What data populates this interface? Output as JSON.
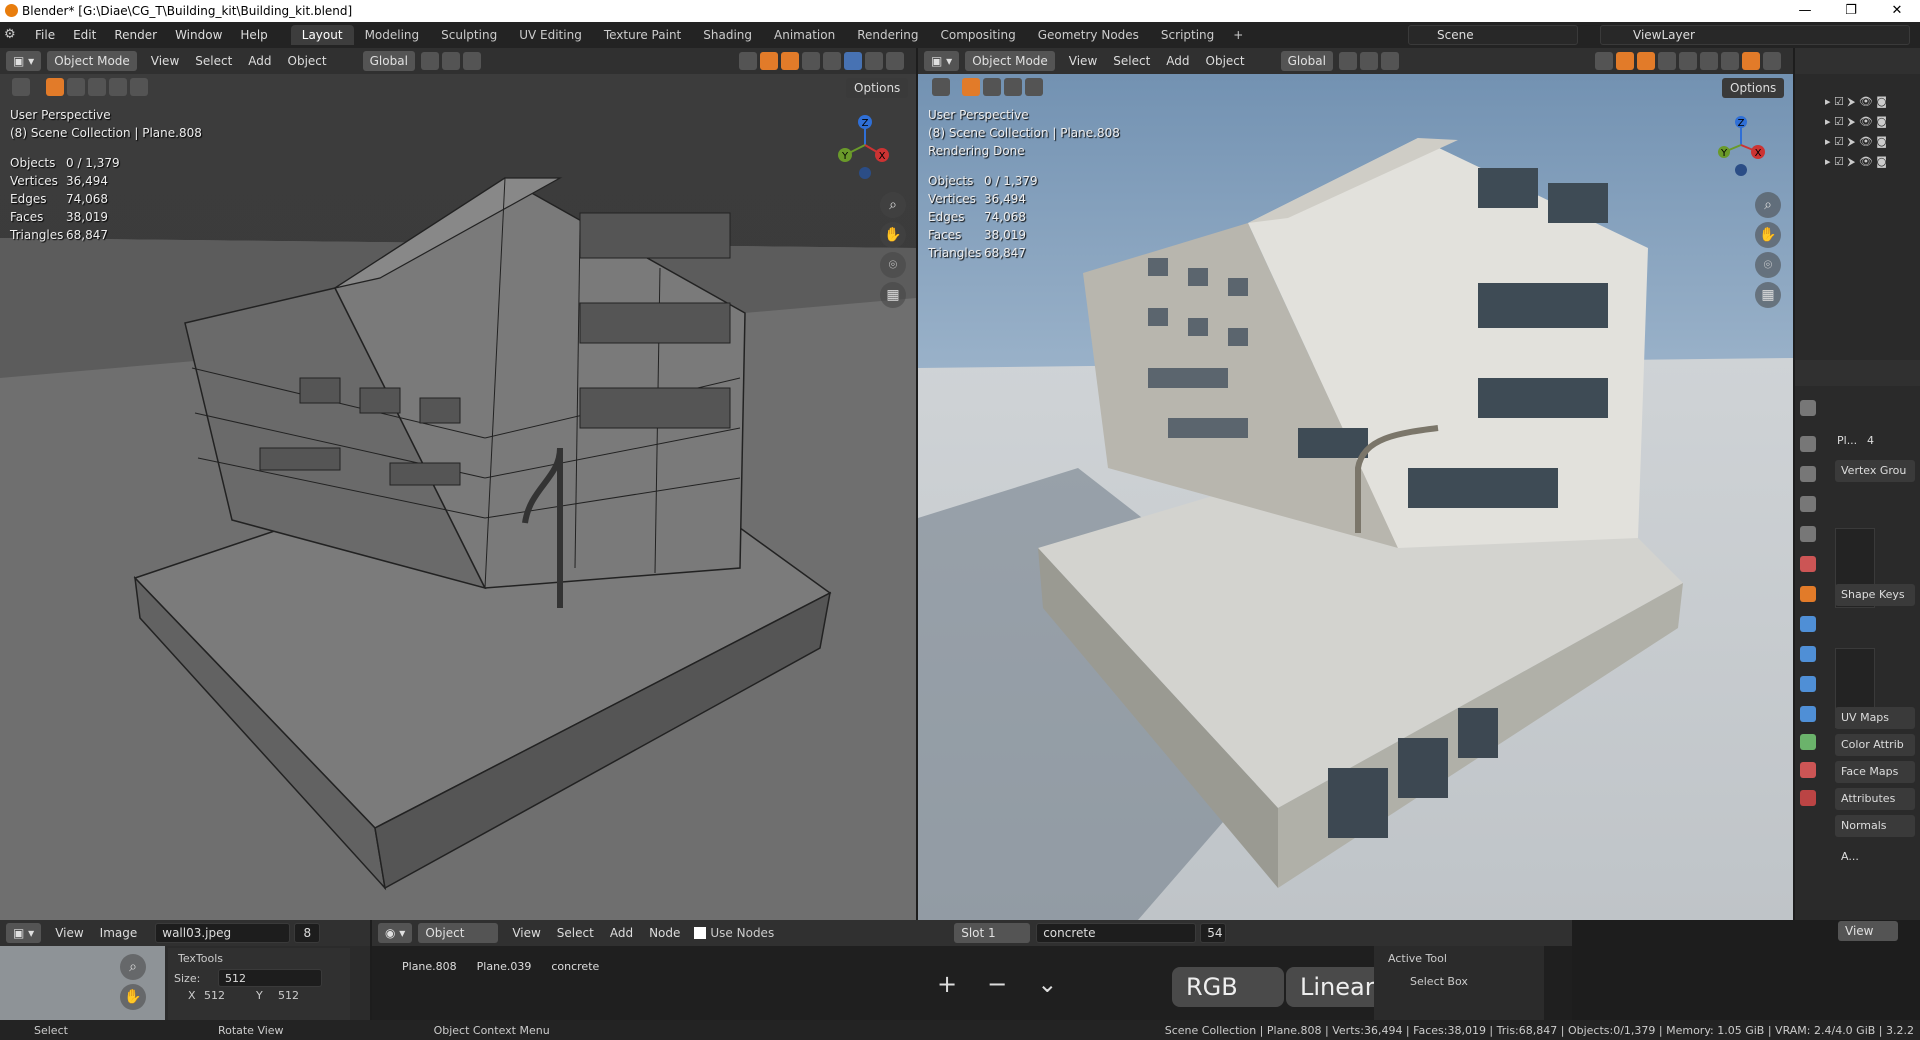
{
  "window": {
    "title": "Blender* [G:\\Diae\\CG_T\\Building_kit\\Building_kit.blend]",
    "min": "—",
    "max": "❐",
    "close": "✕"
  },
  "menus": [
    "File",
    "Edit",
    "Render",
    "Window",
    "Help"
  ],
  "workspaces": [
    "Layout",
    "Modeling",
    "Sculpting",
    "UV Editing",
    "Texture Paint",
    "Shading",
    "Animation",
    "Rendering",
    "Compositing",
    "Geometry Nodes",
    "Scripting"
  ],
  "scene": "Scene",
  "view_layer": "ViewLayer",
  "viewport_left": {
    "mode": "Object Mode",
    "menus": [
      "View",
      "Select",
      "Add",
      "Object"
    ],
    "orientation": "Global",
    "options": "Options",
    "info": [
      "User Perspective",
      "(8) Scene Collection | Plane.808"
    ],
    "stats": [
      [
        "Objects",
        "0 / 1,379"
      ],
      [
        "Vertices",
        "36,494"
      ],
      [
        "Edges",
        "74,068"
      ],
      [
        "Faces",
        "38,019"
      ],
      [
        "Triangles",
        "68,847"
      ]
    ]
  },
  "viewport_right": {
    "mode": "Object Mode",
    "menus": [
      "View",
      "Select",
      "Add",
      "Object"
    ],
    "orientation": "Global",
    "options": "Options",
    "info": [
      "User Perspective",
      "(8) Scene Collection | Plane.808",
      "Rendering Done"
    ],
    "stats": [
      [
        "Objects",
        "0 / 1,379"
      ],
      [
        "Vertices",
        "36,494"
      ],
      [
        "Edges",
        "74,068"
      ],
      [
        "Faces",
        "38,019"
      ],
      [
        "Triangles",
        "68,847"
      ]
    ]
  },
  "gizmo": {
    "x": "X",
    "y": "Y",
    "z": "Z"
  },
  "props": {
    "object_name": "Pl...",
    "users": "4",
    "panels": [
      "Vertex Grou",
      "Shape Keys",
      "UV Maps",
      "Color Attrib",
      "Face Maps",
      "Attributes",
      "Normals"
    ],
    "auto": "A..."
  },
  "image_editor": {
    "menus": [
      "View",
      "Image"
    ],
    "image": "wall03.jpeg",
    "users": "8",
    "panel": "TexTools",
    "size_label": "Size:",
    "size": "512",
    "x_label": "X",
    "x": "512",
    "y_label": "Y",
    "y": "512"
  },
  "node_editor": {
    "mode": "Object",
    "menus": [
      "View",
      "Select",
      "Add",
      "Node"
    ],
    "use_nodes": "Use Nodes",
    "slot": "Slot 1",
    "material": "concrete",
    "users": "54",
    "breadcrumb": [
      "Plane.808",
      "Plane.039",
      "concrete"
    ],
    "color_space": "RGB",
    "interp": "Linear"
  },
  "tool_panel": {
    "header": "Active Tool",
    "tool": "Select Box",
    "view": "View"
  },
  "statusbar": {
    "select": "Select",
    "rotate": "Rotate View",
    "context": "Object Context Menu",
    "info": "Scene Collection | Plane.808 | Verts:36,494 | Faces:38,019 | Tris:68,847 | Objects:0/1,379 | Memory: 1.05 GiB | VRAM: 2.4/4.0 GiB | 3.2.2"
  },
  "colors": {
    "accent": "#e27b29",
    "select": "#4772b3",
    "bg": "#1d1d1d",
    "header": "#303030",
    "grid": "#393939"
  }
}
